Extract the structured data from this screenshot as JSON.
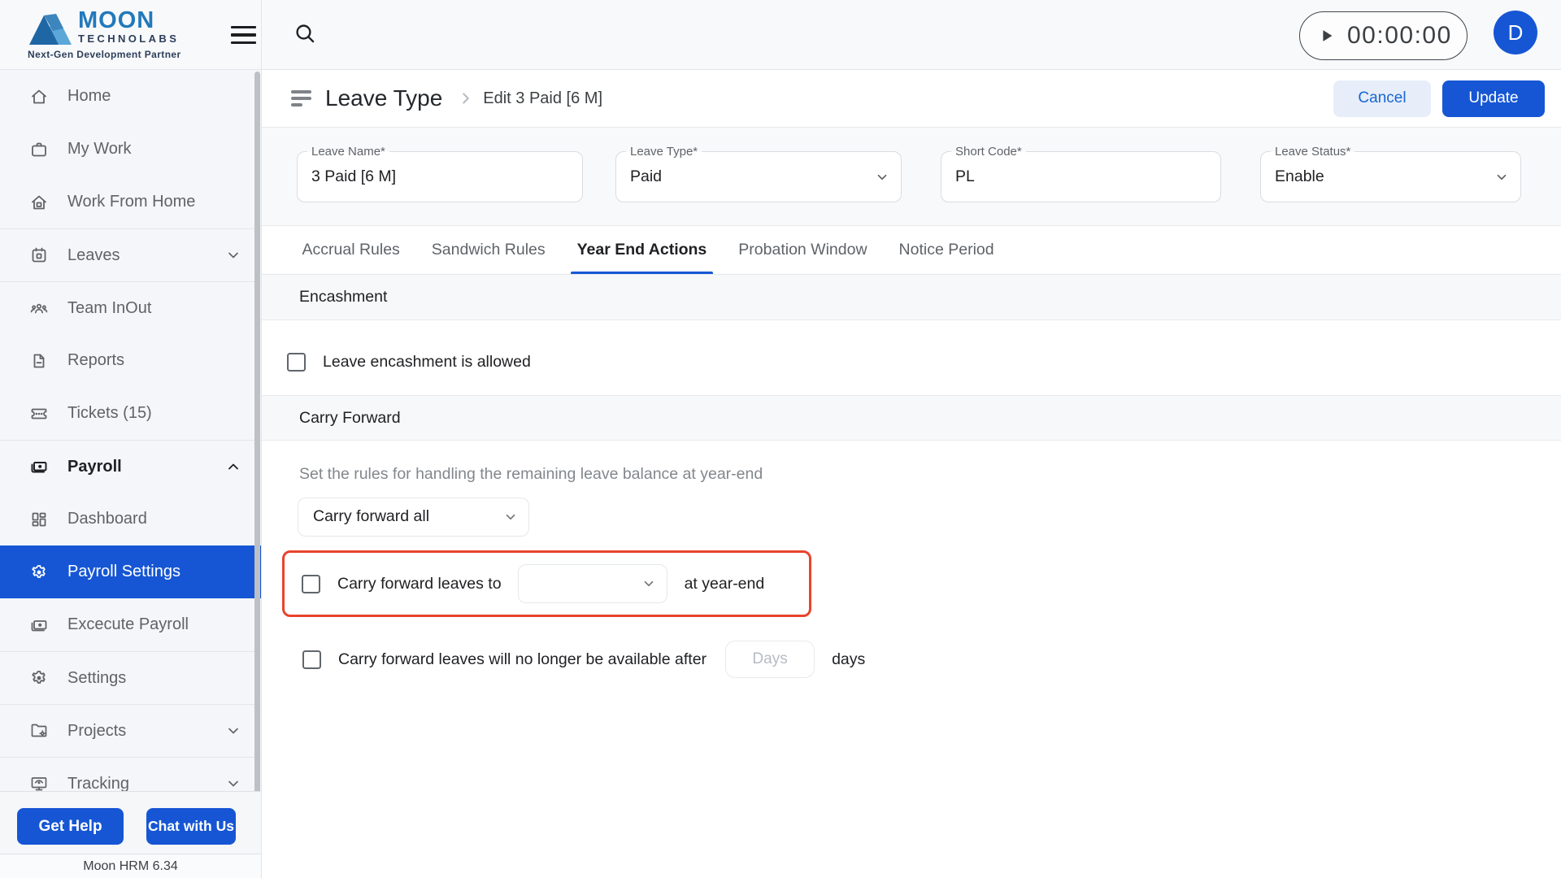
{
  "brand": {
    "name": "MOON",
    "sub": "TECHNOLABS",
    "tagline": "Next-Gen Development Partner"
  },
  "topbar": {
    "timer": "00:00:00",
    "avatar": "D"
  },
  "sidebar": {
    "items": [
      {
        "label": "Home",
        "icon": "home-icon"
      },
      {
        "label": "My Work",
        "icon": "briefcase-icon"
      },
      {
        "label": "Work From Home",
        "icon": "home-office-icon"
      },
      {
        "label": "Leaves",
        "icon": "calendar-icon",
        "chevron": "down"
      },
      {
        "label": "Team InOut",
        "icon": "team-icon"
      },
      {
        "label": "Reports",
        "icon": "report-icon"
      },
      {
        "label": "Tickets (15)",
        "icon": "ticket-icon"
      },
      {
        "label": "Payroll",
        "icon": "payroll-icon",
        "chevron": "up",
        "expanded": true
      },
      {
        "label": "Dashboard",
        "icon": "dashboard-icon"
      },
      {
        "label": "Payroll Settings",
        "icon": "gear-icon",
        "active": true
      },
      {
        "label": "Excecute Payroll",
        "icon": "payroll-icon"
      },
      {
        "label": "Settings",
        "icon": "gear-icon"
      },
      {
        "label": "Projects",
        "icon": "projects-icon",
        "chevron": "down"
      },
      {
        "label": "Tracking",
        "icon": "tracking-icon",
        "chevron": "down"
      }
    ],
    "get_help": "Get Help",
    "chat_with_us": "Chat with Us",
    "version": "Moon HRM 6.34"
  },
  "page": {
    "title": "Leave Type",
    "breadcrumb": "Edit 3 Paid [6 M]",
    "cancel": "Cancel",
    "update": "Update"
  },
  "form": {
    "leave_name": {
      "label": "Leave Name*",
      "value": "3 Paid [6 M]"
    },
    "leave_type": {
      "label": "Leave Type*",
      "value": "Paid"
    },
    "short_code": {
      "label": "Short Code*",
      "value": "PL"
    },
    "leave_status": {
      "label": "Leave Status*",
      "value": "Enable"
    }
  },
  "tabs": [
    {
      "label": "Accrual Rules"
    },
    {
      "label": "Sandwich Rules"
    },
    {
      "label": "Year End Actions",
      "active": true
    },
    {
      "label": "Probation Window"
    },
    {
      "label": "Notice Period"
    }
  ],
  "content": {
    "encashment": {
      "heading": "Encashment",
      "checkbox_label": "Leave encashment is allowed",
      "checked": false
    },
    "carry_forward": {
      "heading": "Carry Forward",
      "description": "Set the rules for handling the remaining leave balance at year-end",
      "mode_select_value": "Carry forward all",
      "carry_to_row": {
        "checkbox_label": "Carry forward leaves to",
        "select_value": "",
        "suffix_label": "at year-end",
        "checked": false,
        "highlighted": true
      },
      "expiry_row": {
        "checkbox_label": "Carry forward leaves will no longer be available after",
        "input_placeholder": "Days",
        "input_value": "",
        "suffix_label": "days",
        "checked": false
      }
    }
  },
  "colors": {
    "primary_blue": "#1656d4",
    "highlight_red": "#e8432d",
    "cancel_bg": "#e7edf9",
    "cancel_text": "#1967d2",
    "sidebar_bg": "#f4f6f9",
    "band_bg": "#f7f8f9"
  }
}
